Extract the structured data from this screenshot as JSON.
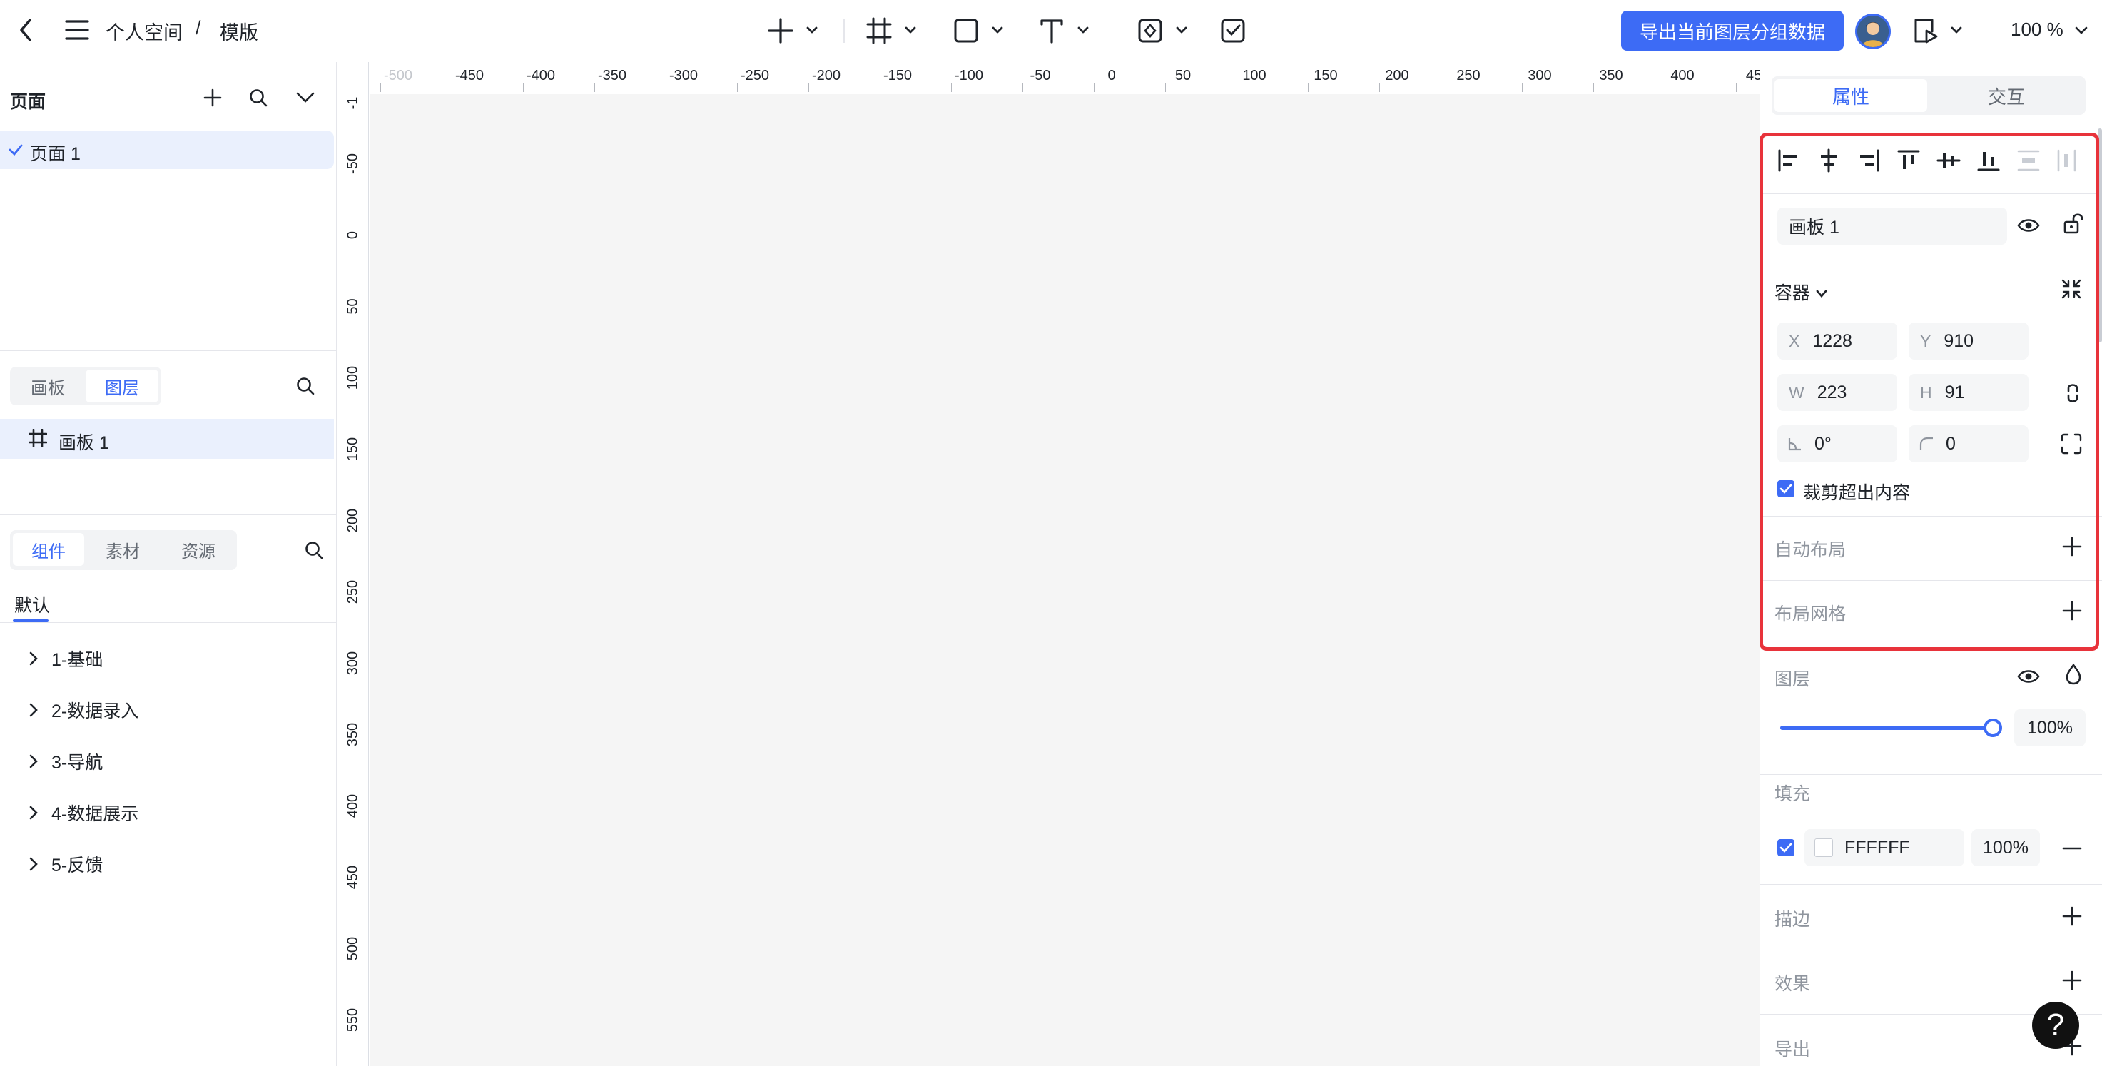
{
  "header": {
    "breadcrumb_space": "个人空间",
    "breadcrumb_sep": "/",
    "breadcrumb_file": "模版",
    "export_button": "导出当前图层分组数据",
    "zoom": "100 %"
  },
  "pages_panel": {
    "title": "页面",
    "pages": [
      {
        "label": "页面 1",
        "selected": true
      }
    ]
  },
  "layers_panel": {
    "tabs": [
      "画板",
      "图层"
    ],
    "active_tab": "图层",
    "layers": [
      {
        "label": "画板 1"
      }
    ]
  },
  "assets_panel": {
    "tabs": [
      "组件",
      "素材",
      "资源"
    ],
    "active_tab": "组件",
    "subtab": "默认",
    "groups": [
      "1-基础",
      "2-数据录入",
      "3-导航",
      "4-数据展示",
      "5-反馈"
    ]
  },
  "ruler": {
    "top": [
      "-500",
      "-450",
      "-400",
      "-350",
      "-300",
      "-250",
      "-200",
      "-150",
      "-100",
      "-50",
      "0",
      "50",
      "100",
      "150",
      "200",
      "250",
      "300",
      "350",
      "400",
      "45"
    ],
    "left": [
      "-1",
      "-50",
      "0",
      "50",
      "100",
      "150",
      "200",
      "250",
      "300",
      "350",
      "400",
      "450",
      "500",
      "550"
    ]
  },
  "properties": {
    "tabs": [
      "属性",
      "交互"
    ],
    "active_tab": "属性",
    "frame_name": "画板 1",
    "container_label": "容器",
    "x_label": "X",
    "x": "1228",
    "y_label": "Y",
    "y": "910",
    "w_label": "W",
    "w": "223",
    "h_label": "H",
    "h": "91",
    "rotation": "0°",
    "radius": "0",
    "clip_label": "裁剪超出内容",
    "auto_layout": "自动布局",
    "layout_grid": "布局网格",
    "layer_label": "图层",
    "opacity": "100%",
    "opacity_value": 1.0,
    "fill_label": "填充",
    "fill_hex": "FFFFFF",
    "fill_opacity": "100%",
    "stroke_label": "描边",
    "effect_label": "效果",
    "export_label": "导出"
  },
  "help": "?",
  "colors": {
    "accent": "#3d6bf5",
    "highlight_box": "#e8333b",
    "canvas": "#f5f5f5"
  }
}
